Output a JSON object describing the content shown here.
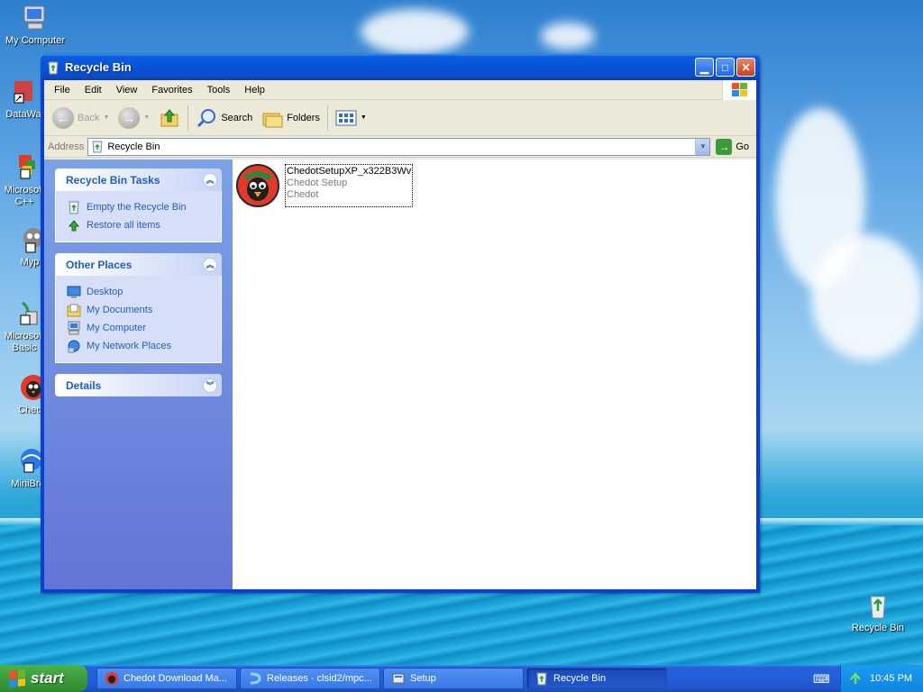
{
  "desktop": {
    "icons": [
      {
        "label": "My Computer",
        "icon": "my-computer-icon"
      },
      {
        "label": "DataWa",
        "icon": "shortcut-icon"
      },
      {
        "label": "Microsoft\nC++",
        "icon": "shortcut-icon"
      },
      {
        "label": "Myp",
        "icon": "shortcut-icon"
      },
      {
        "label": "Microsoft\nBasic",
        "icon": "shortcut-icon"
      },
      {
        "label": "Chec",
        "icon": "chedot-icon"
      },
      {
        "label": "MiniBro",
        "icon": "shortcut-icon"
      },
      {
        "label": "Recycle Bin",
        "icon": "recycle-bin-icon"
      }
    ]
  },
  "window": {
    "title": "Recycle Bin",
    "menu": [
      "File",
      "Edit",
      "View",
      "Favorites",
      "Tools",
      "Help"
    ],
    "toolbar": {
      "back": "Back",
      "search": "Search",
      "folders": "Folders"
    },
    "address": {
      "label": "Address",
      "value": "Recycle Bin",
      "go": "Go"
    },
    "tasks_panel": {
      "title": "Recycle Bin Tasks",
      "items": [
        "Empty the Recycle Bin",
        "Restore all items"
      ]
    },
    "places_panel": {
      "title": "Other Places",
      "items": [
        "Desktop",
        "My Documents",
        "My Computer",
        "My Network Places"
      ]
    },
    "details_panel": {
      "title": "Details"
    },
    "file": {
      "name": "ChedotSetupXP_x322B3Wv",
      "description": "Chedot Setup",
      "company": "Chedot"
    }
  },
  "taskbar": {
    "start": "start",
    "tasks": [
      {
        "label": "Chedot Download Ma...",
        "active": false
      },
      {
        "label": "Releases · clsid2/mpc...",
        "active": false
      },
      {
        "label": "Setup",
        "active": false
      },
      {
        "label": "Recycle Bin",
        "active": true
      }
    ],
    "clock": "10:45 PM"
  },
  "colors": {
    "window_blue": "#0a3fd0",
    "link_blue": "#215dc6",
    "task_pane": "#6375d6",
    "start_green": "#3c9c3c"
  }
}
